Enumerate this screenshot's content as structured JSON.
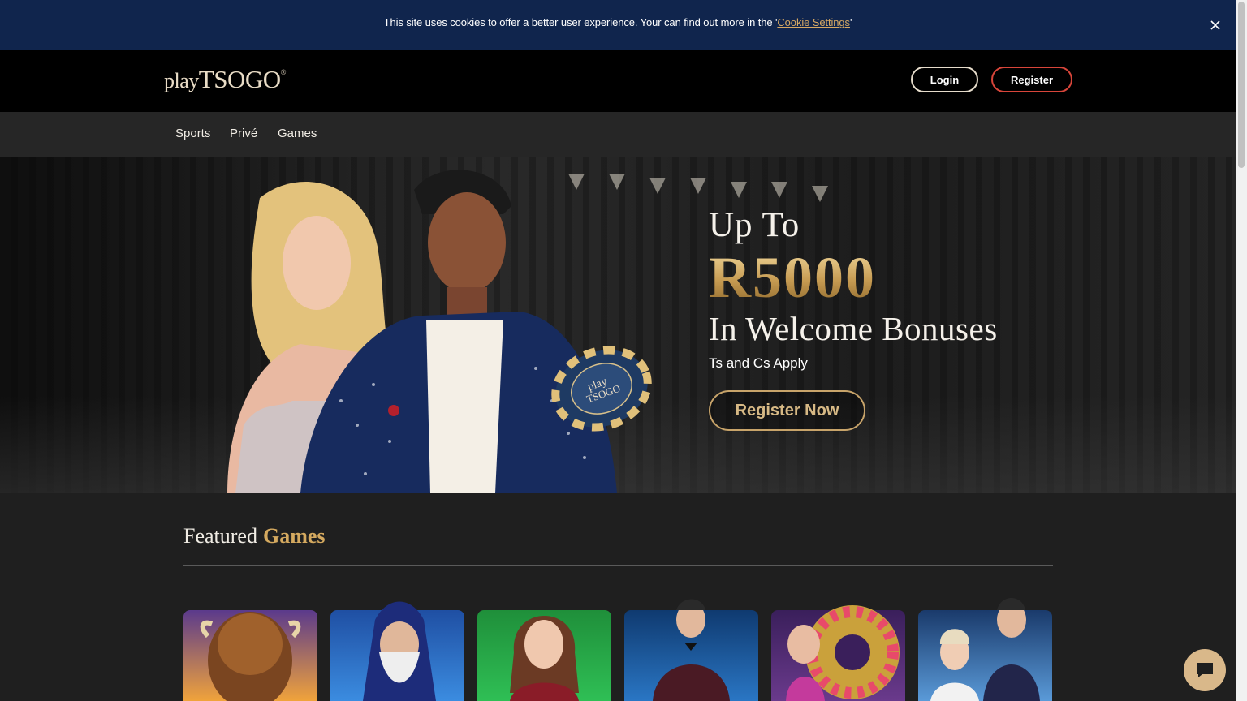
{
  "cookie": {
    "text_before": "This site uses cookies to offer a better user experience. Your can find out more in the '",
    "link_label": "Cookie Settings",
    "text_after": "'",
    "close_icon": "close-icon"
  },
  "header": {
    "logo_play": "play",
    "logo_tsogo": "TSOGO",
    "logo_mark": "®",
    "login_label": "Login",
    "register_label": "Register"
  },
  "nav": {
    "items": [
      {
        "label": "Sports"
      },
      {
        "label": "Privé"
      },
      {
        "label": "Games"
      }
    ]
  },
  "hero": {
    "line1": "Up To",
    "amount": "R5000",
    "line3": "In Welcome Bonuses",
    "terms": "Ts and Cs Apply",
    "cta_label": "Register Now",
    "chip_text_play": "play",
    "chip_text_tsogo": "TSOGO"
  },
  "featured": {
    "title": "Featured",
    "title_accent": "Games",
    "games": [
      {
        "name": "buffalo-slot",
        "colors": [
          "#5b3a8c",
          "#f0a33b"
        ]
      },
      {
        "name": "wizard-slot",
        "colors": [
          "#1f4fa3",
          "#3b8ce0"
        ]
      },
      {
        "name": "live-dealer-green",
        "colors": [
          "#1f8f3a",
          "#2fbf55"
        ]
      },
      {
        "name": "live-host-blue",
        "colors": [
          "#0f3a70",
          "#2a76c4"
        ]
      },
      {
        "name": "wonderland-wheel",
        "colors": [
          "#3a1f5b",
          "#caa13b"
        ]
      },
      {
        "name": "live-blackjack",
        "colors": [
          "#1a3a6b",
          "#5a9ad8"
        ]
      }
    ]
  },
  "colors": {
    "cookie_bar": "#10254d",
    "gold": "#d4a95f",
    "register_border": "#d8453a"
  },
  "chat": {
    "icon": "chat-icon"
  }
}
